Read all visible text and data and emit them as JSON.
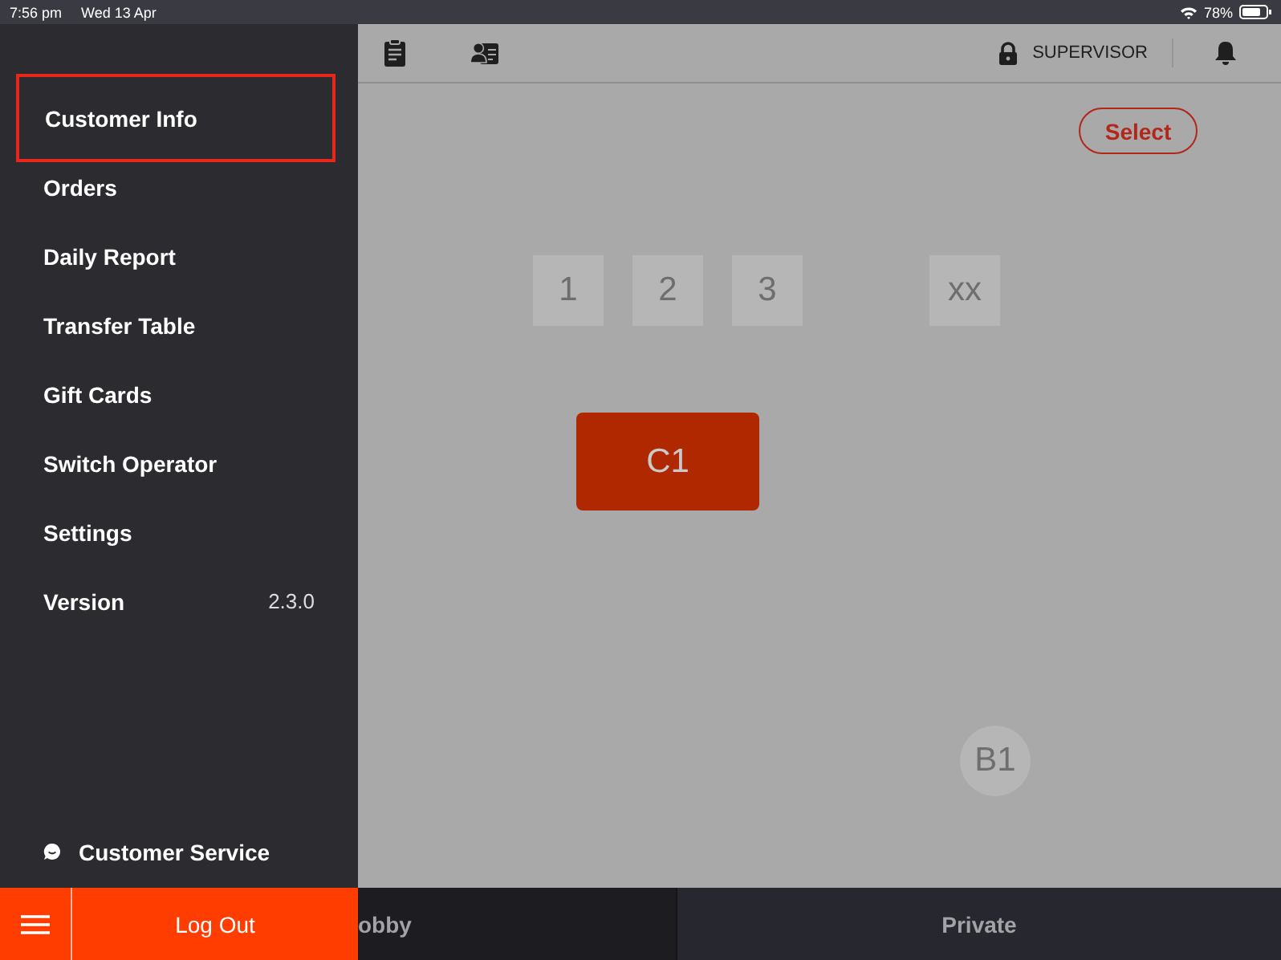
{
  "status_bar": {
    "time": "7:56 pm",
    "date": "Wed 13 Apr",
    "battery": "78%"
  },
  "sidebar": {
    "items": [
      {
        "label": "Customer Info",
        "selected": true
      },
      {
        "label": "Orders",
        "selected": false
      },
      {
        "label": "Daily Report",
        "selected": false
      },
      {
        "label": "Transfer Table",
        "selected": false
      },
      {
        "label": "Gift Cards",
        "selected": false
      },
      {
        "label": "Switch Operator",
        "selected": false
      },
      {
        "label": "Settings",
        "selected": false
      },
      {
        "label": "Version",
        "value": "2.3.0",
        "selected": false
      }
    ],
    "customer_service": "Customer Service",
    "logout": "Log Out"
  },
  "header": {
    "role": "SUPERVISOR"
  },
  "select_button": "Select",
  "tables": [
    {
      "label": "1",
      "kind": "square",
      "occupied": false
    },
    {
      "label": "2",
      "kind": "square",
      "occupied": false
    },
    {
      "label": "3",
      "kind": "square",
      "occupied": false
    },
    {
      "label": "xx",
      "kind": "square",
      "occupied": false
    },
    {
      "label": "C1",
      "kind": "rect",
      "occupied": true
    },
    {
      "label": "B1",
      "kind": "round",
      "occupied": false
    }
  ],
  "tabs": [
    {
      "label": "obby",
      "selected": true
    },
    {
      "label": "Private",
      "selected": false
    }
  ]
}
